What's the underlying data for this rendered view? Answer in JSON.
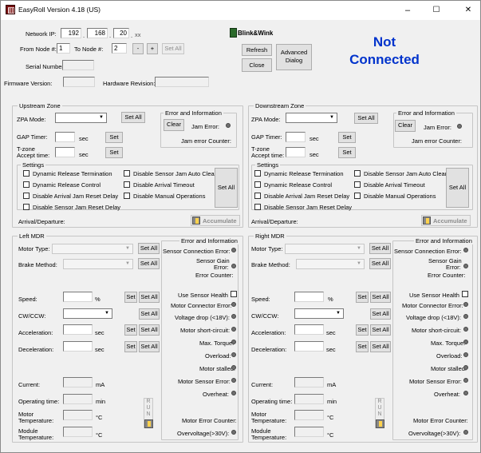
{
  "window": {
    "title": "EasyRoll Version 4.18 (US)",
    "minimize": "–",
    "maximize": "☐",
    "close": "✕"
  },
  "top": {
    "network_ip_label": "Network IP:",
    "ip": [
      "192",
      "168",
      "20"
    ],
    "ip_suffix": "xx",
    "dot": ".",
    "from_node_label": "From Node #:",
    "from_node": "1",
    "to_node_label": "To Node #:",
    "to_node": "2",
    "minus": "-",
    "plus": "+",
    "set_all": "Set All",
    "serial_label": "Serial Number:",
    "serial": "",
    "firmware_label": "Firmware Version:",
    "firmware": "",
    "hardware_label": "Hardware Revision:",
    "hardware": "",
    "blink_label": "Blink&Wink",
    "refresh": "Refresh",
    "close": "Close",
    "advanced": "Advanced Dialog",
    "status_line1": "Not",
    "status_line2": "Connected"
  },
  "upstream": {
    "title": "Upstream Zone",
    "zpa_mode": "ZPA Mode:",
    "set_all": "Set All",
    "gap_timer": "GAP Timer:",
    "sec": "sec",
    "set": "Set",
    "tzone1": "T-zone",
    "tzone2": "Accept time:",
    "err_title": "Error and Information",
    "clear": "Clear",
    "jam_error": "Jam Error:",
    "jam_counter": "Jam error Counter:",
    "settings": "Settings",
    "cb": [
      "Dynamic Release Termination",
      "Disable Sensor Jam Auto Clear",
      "Dynamic Release Control",
      "Disable Arrival Timeout",
      "Disable Arrival Jam Reset Delay",
      "Disable Manual Operations",
      "Disable Sensor Jam Reset Delay"
    ],
    "settings_set_all": "Set All",
    "arrival": "Arrival/Departure:",
    "accumulate": "Accumulate"
  },
  "downstream": {
    "title": "Downstream Zone",
    "zpa_mode": "ZPA Mode:",
    "set_all": "Set All",
    "gap_timer": "GAP Timer:",
    "sec": "sec",
    "set": "Set",
    "tzone1": "T-zone",
    "tzone2": "Accept time:",
    "err_title": "Error and Information",
    "clear": "Clear",
    "jam_error": "Jam Error:",
    "jam_counter": "Jam error Counter:",
    "settings": "Settings",
    "cb": [
      "Dynamic Release Termination",
      "Disable Sensor Jam Auto Clear",
      "Dynamic Release Control",
      "Disable Arrival Timeout",
      "Disable Arrival Jam Reset Delay",
      "Disable Manual Operations",
      "Disable Sensor Jam Reset Delay"
    ],
    "settings_set_all": "Set All",
    "arrival": "Arrival/Departure:",
    "accumulate": "Accumulate"
  },
  "left_mdr": {
    "title": "Left MDR",
    "motor_type": "Motor Type:",
    "brake": "Brake Method:",
    "set_all": "Set All",
    "set": "Set",
    "speed": "Speed:",
    "pct": "%",
    "cwccw": "CW/CCW:",
    "accel": "Acceleration:",
    "decel": "Deceleration:",
    "sec": "sec",
    "current": "Current:",
    "ma": "mA",
    "op_time": "Operating time:",
    "min": "min",
    "motor_temp1": "Motor",
    "motor_temp2": "Temperature:",
    "module_temp1": "Module",
    "module_temp2": "Temperature:",
    "degc": "°C",
    "run": [
      "R",
      "U",
      "N"
    ],
    "err_title": "Error and Information",
    "sensor_conn": "Sensor Connection Error:",
    "sensor_gain1": "Sensor Gain",
    "sensor_gain2": "Error:",
    "err_counter": "Error Counter:",
    "use_health": "Use Sensor Health",
    "motor_conn": "Motor Connector Error:",
    "vdrop": "Voltage drop (<18V):",
    "short": "Motor short-circuit:",
    "max_torque1": "Max. Torque:",
    "max_torque2": "Overload:",
    "stalled": "Motor stalled:",
    "motor_sensor": "Motor Sensor Error:",
    "overheat": "Overheat:",
    "motor_err_counter": "Motor Error Counter:",
    "overvolt": "Overvoltage(>30V):"
  },
  "right_mdr": {
    "title": "Right MDR",
    "motor_type": "Motor Type:",
    "brake": "Brake Method:",
    "set_all": "Set All",
    "set": "Set",
    "speed": "Speed:",
    "pct": "%",
    "cwccw": "CW/CCW:",
    "accel": "Acceleration:",
    "decel": "Deceleration:",
    "sec": "sec",
    "current": "Current:",
    "ma": "mA",
    "op_time": "Operating time:",
    "min": "min",
    "motor_temp1": "Motor",
    "motor_temp2": "Temperature:",
    "module_temp1": "Module",
    "module_temp2": "Temperature:",
    "degc": "°C",
    "run": [
      "R",
      "U",
      "N"
    ],
    "err_title": "Error and Information",
    "sensor_conn": "Sensor Connection Error:",
    "sensor_gain1": "Sensor Gain",
    "sensor_gain2": "Error:",
    "err_counter": "Error Counter:",
    "use_health": "Use Sensor Health",
    "motor_conn": "Motor Connector Error:",
    "vdrop": "Voltage drop (<18V):",
    "short": "Motor short-circuit:",
    "max_torque1": "Max. Torque:",
    "max_torque2": "Overload:",
    "stalled": "Motor stalled:",
    "motor_sensor": "Motor Sensor Error:",
    "overheat": "Overheat:",
    "motor_err_counter": "Motor Error Counter:",
    "overvolt": "Overvoltage(>30V):"
  },
  "colors": {
    "status": "#0033cc"
  }
}
